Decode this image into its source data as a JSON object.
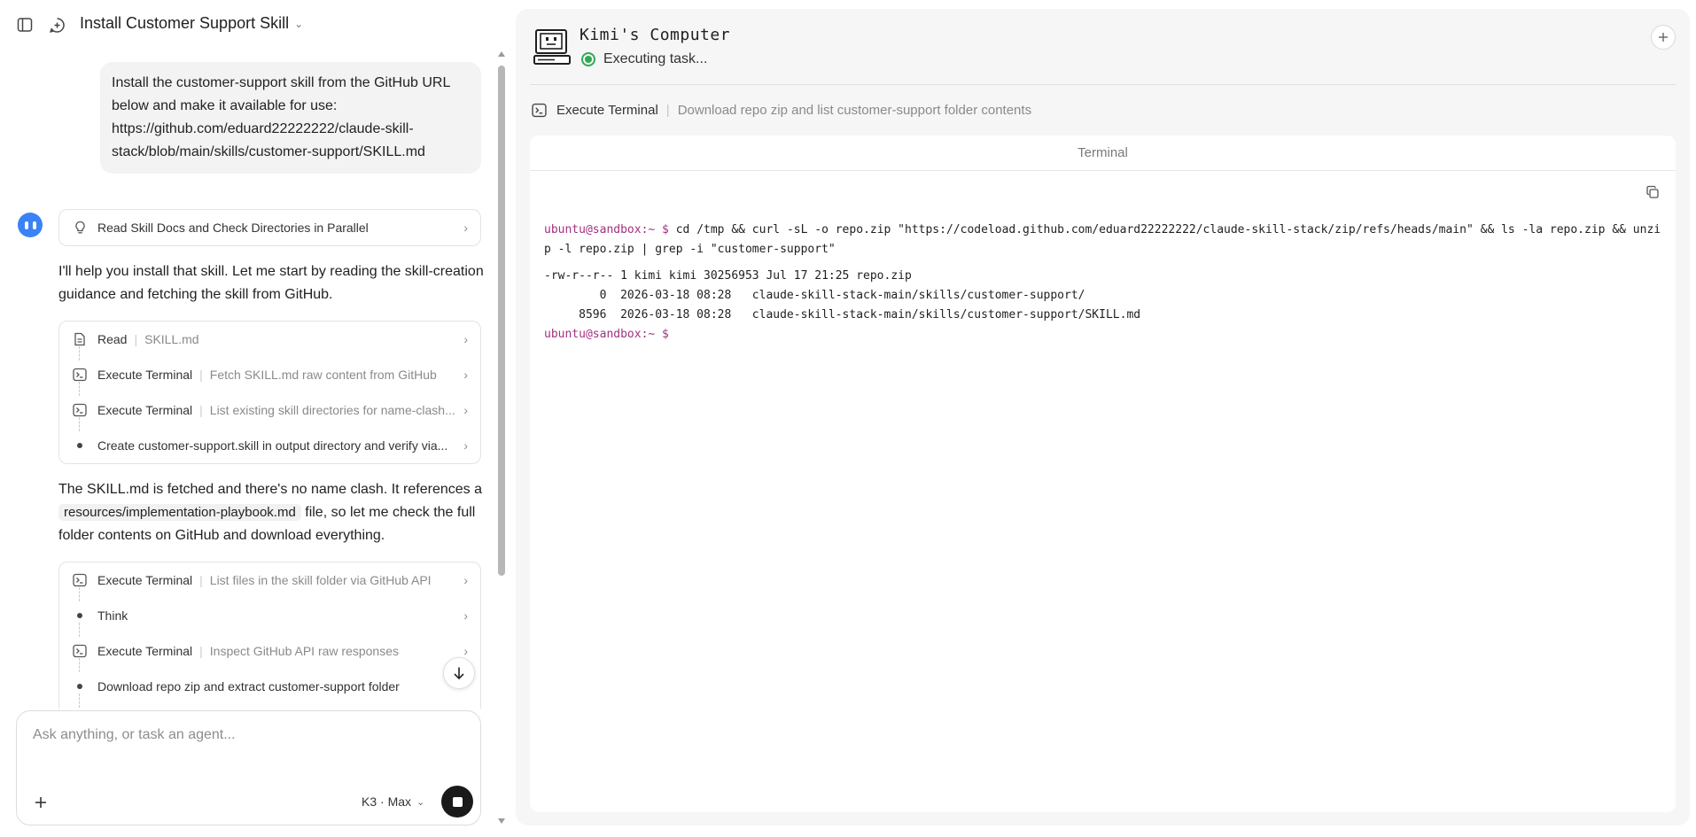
{
  "header": {
    "title": "Install Customer Support Skill"
  },
  "user_message": "Install the customer-support skill from the GitHub URL below and make it available for use: https://github.com/eduard22222222/claude-skill-stack/blob/main/skills/customer-support/SKILL.md",
  "assistant": {
    "first_step": "Read Skill Docs and Check Directories in Parallel",
    "para1": "I'll help you install that skill. Let me start by reading the skill-creation guidance and fetching the skill from GitHub.",
    "steps1": [
      {
        "icon": "file-icon",
        "name": "Read",
        "desc": "SKILL.md"
      },
      {
        "icon": "terminal-icon",
        "name": "Execute Terminal",
        "desc": "Fetch SKILL.md raw content from GitHub"
      },
      {
        "icon": "terminal-icon",
        "name": "Execute Terminal",
        "desc": "List existing skill directories for name-clash..."
      },
      {
        "icon": "bullet",
        "name": "Create customer-support.skill in output directory and verify via...",
        "desc": ""
      }
    ],
    "para2_before": "The SKILL.md is fetched and there's no name clash. It references a",
    "para2_code": "resources/implementation-playbook.md",
    "para2_after": "file, so let me check the full folder contents on GitHub and download everything.",
    "steps2": [
      {
        "icon": "terminal-icon",
        "name": "Execute Terminal",
        "desc": "List files in the skill folder via GitHub API"
      },
      {
        "icon": "bullet",
        "name": "Think",
        "desc": ""
      },
      {
        "icon": "terminal-icon",
        "name": "Execute Terminal",
        "desc": "Inspect GitHub API raw responses"
      },
      {
        "icon": "bullet",
        "name": "Download repo zip and extract customer-support folder",
        "desc": ""
      }
    ]
  },
  "composer": {
    "placeholder": "Ask anything, or task an agent...",
    "model": "K3 · Max"
  },
  "computer": {
    "name": "Kimi's Computer",
    "status": "Executing task...",
    "tool_name": "Execute Terminal",
    "tool_desc": "Download repo zip and list customer-support folder contents",
    "terminal_title": "Terminal",
    "prompt": "ubuntu@sandbox:~ $",
    "command": "cd /tmp && curl -sL -o repo.zip \"https://codeload.github.com/eduard22222222/claude-skill-stack/zip/refs/heads/main\" && ls -la repo.zip && unzip -l repo.zip | grep -i \"customer-support\"",
    "output": [
      "-rw-r--r-- 1 kimi kimi 30256953 Jul 17 21:25 repo.zip",
      "        0  2026-03-18 08:28   claude-skill-stack-main/skills/customer-support/",
      "     8596  2026-03-18 08:28   claude-skill-stack-main/skills/customer-support/SKILL.md"
    ],
    "final_prompt": "ubuntu@sandbox:~ $"
  },
  "colors": {
    "accent_blue": "#3b82f6",
    "status_green": "#2faa53",
    "prompt_purple": "#a2317f"
  }
}
